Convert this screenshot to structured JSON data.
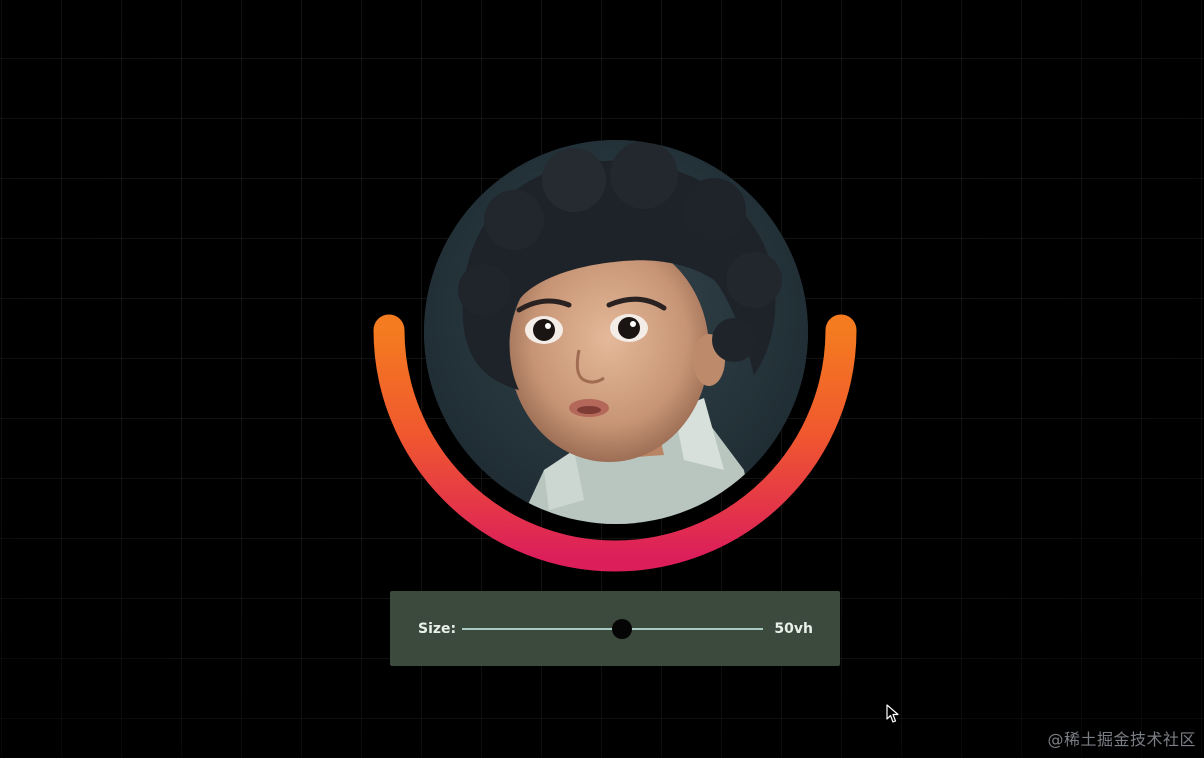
{
  "controls": {
    "size_label": "Size:",
    "size_value": "50vh",
    "size_slider_fraction": 0.53
  },
  "avatar": {
    "alt": "child portrait",
    "arc_colors": {
      "top": "#f47b20",
      "bottom": "#dc1f5a"
    }
  },
  "watermark": "@稀土掘金技术社区",
  "icons": {
    "cursor": "mouse-pointer-icon"
  }
}
